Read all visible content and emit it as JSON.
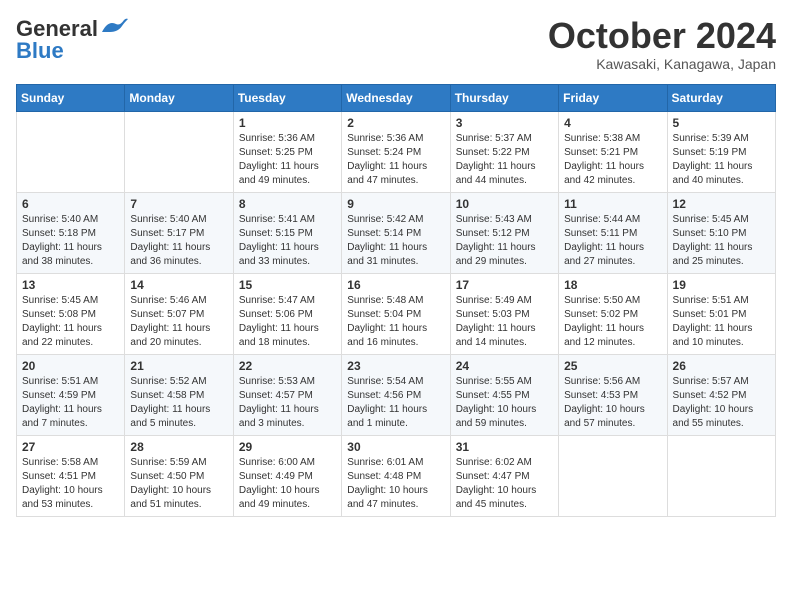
{
  "logo": {
    "general": "General",
    "blue": "Blue"
  },
  "title": "October 2024",
  "location": "Kawasaki, Kanagawa, Japan",
  "days": [
    "Sunday",
    "Monday",
    "Tuesday",
    "Wednesday",
    "Thursday",
    "Friday",
    "Saturday"
  ],
  "weeks": [
    [
      {
        "day": "",
        "sunrise": "",
        "sunset": "",
        "daylight": ""
      },
      {
        "day": "",
        "sunrise": "",
        "sunset": "",
        "daylight": ""
      },
      {
        "day": "1",
        "sunrise": "Sunrise: 5:36 AM",
        "sunset": "Sunset: 5:25 PM",
        "daylight": "Daylight: 11 hours and 49 minutes."
      },
      {
        "day": "2",
        "sunrise": "Sunrise: 5:36 AM",
        "sunset": "Sunset: 5:24 PM",
        "daylight": "Daylight: 11 hours and 47 minutes."
      },
      {
        "day": "3",
        "sunrise": "Sunrise: 5:37 AM",
        "sunset": "Sunset: 5:22 PM",
        "daylight": "Daylight: 11 hours and 44 minutes."
      },
      {
        "day": "4",
        "sunrise": "Sunrise: 5:38 AM",
        "sunset": "Sunset: 5:21 PM",
        "daylight": "Daylight: 11 hours and 42 minutes."
      },
      {
        "day": "5",
        "sunrise": "Sunrise: 5:39 AM",
        "sunset": "Sunset: 5:19 PM",
        "daylight": "Daylight: 11 hours and 40 minutes."
      }
    ],
    [
      {
        "day": "6",
        "sunrise": "Sunrise: 5:40 AM",
        "sunset": "Sunset: 5:18 PM",
        "daylight": "Daylight: 11 hours and 38 minutes."
      },
      {
        "day": "7",
        "sunrise": "Sunrise: 5:40 AM",
        "sunset": "Sunset: 5:17 PM",
        "daylight": "Daylight: 11 hours and 36 minutes."
      },
      {
        "day": "8",
        "sunrise": "Sunrise: 5:41 AM",
        "sunset": "Sunset: 5:15 PM",
        "daylight": "Daylight: 11 hours and 33 minutes."
      },
      {
        "day": "9",
        "sunrise": "Sunrise: 5:42 AM",
        "sunset": "Sunset: 5:14 PM",
        "daylight": "Daylight: 11 hours and 31 minutes."
      },
      {
        "day": "10",
        "sunrise": "Sunrise: 5:43 AM",
        "sunset": "Sunset: 5:12 PM",
        "daylight": "Daylight: 11 hours and 29 minutes."
      },
      {
        "day": "11",
        "sunrise": "Sunrise: 5:44 AM",
        "sunset": "Sunset: 5:11 PM",
        "daylight": "Daylight: 11 hours and 27 minutes."
      },
      {
        "day": "12",
        "sunrise": "Sunrise: 5:45 AM",
        "sunset": "Sunset: 5:10 PM",
        "daylight": "Daylight: 11 hours and 25 minutes."
      }
    ],
    [
      {
        "day": "13",
        "sunrise": "Sunrise: 5:45 AM",
        "sunset": "Sunset: 5:08 PM",
        "daylight": "Daylight: 11 hours and 22 minutes."
      },
      {
        "day": "14",
        "sunrise": "Sunrise: 5:46 AM",
        "sunset": "Sunset: 5:07 PM",
        "daylight": "Daylight: 11 hours and 20 minutes."
      },
      {
        "day": "15",
        "sunrise": "Sunrise: 5:47 AM",
        "sunset": "Sunset: 5:06 PM",
        "daylight": "Daylight: 11 hours and 18 minutes."
      },
      {
        "day": "16",
        "sunrise": "Sunrise: 5:48 AM",
        "sunset": "Sunset: 5:04 PM",
        "daylight": "Daylight: 11 hours and 16 minutes."
      },
      {
        "day": "17",
        "sunrise": "Sunrise: 5:49 AM",
        "sunset": "Sunset: 5:03 PM",
        "daylight": "Daylight: 11 hours and 14 minutes."
      },
      {
        "day": "18",
        "sunrise": "Sunrise: 5:50 AM",
        "sunset": "Sunset: 5:02 PM",
        "daylight": "Daylight: 11 hours and 12 minutes."
      },
      {
        "day": "19",
        "sunrise": "Sunrise: 5:51 AM",
        "sunset": "Sunset: 5:01 PM",
        "daylight": "Daylight: 11 hours and 10 minutes."
      }
    ],
    [
      {
        "day": "20",
        "sunrise": "Sunrise: 5:51 AM",
        "sunset": "Sunset: 4:59 PM",
        "daylight": "Daylight: 11 hours and 7 minutes."
      },
      {
        "day": "21",
        "sunrise": "Sunrise: 5:52 AM",
        "sunset": "Sunset: 4:58 PM",
        "daylight": "Daylight: 11 hours and 5 minutes."
      },
      {
        "day": "22",
        "sunrise": "Sunrise: 5:53 AM",
        "sunset": "Sunset: 4:57 PM",
        "daylight": "Daylight: 11 hours and 3 minutes."
      },
      {
        "day": "23",
        "sunrise": "Sunrise: 5:54 AM",
        "sunset": "Sunset: 4:56 PM",
        "daylight": "Daylight: 11 hours and 1 minute."
      },
      {
        "day": "24",
        "sunrise": "Sunrise: 5:55 AM",
        "sunset": "Sunset: 4:55 PM",
        "daylight": "Daylight: 10 hours and 59 minutes."
      },
      {
        "day": "25",
        "sunrise": "Sunrise: 5:56 AM",
        "sunset": "Sunset: 4:53 PM",
        "daylight": "Daylight: 10 hours and 57 minutes."
      },
      {
        "day": "26",
        "sunrise": "Sunrise: 5:57 AM",
        "sunset": "Sunset: 4:52 PM",
        "daylight": "Daylight: 10 hours and 55 minutes."
      }
    ],
    [
      {
        "day": "27",
        "sunrise": "Sunrise: 5:58 AM",
        "sunset": "Sunset: 4:51 PM",
        "daylight": "Daylight: 10 hours and 53 minutes."
      },
      {
        "day": "28",
        "sunrise": "Sunrise: 5:59 AM",
        "sunset": "Sunset: 4:50 PM",
        "daylight": "Daylight: 10 hours and 51 minutes."
      },
      {
        "day": "29",
        "sunrise": "Sunrise: 6:00 AM",
        "sunset": "Sunset: 4:49 PM",
        "daylight": "Daylight: 10 hours and 49 minutes."
      },
      {
        "day": "30",
        "sunrise": "Sunrise: 6:01 AM",
        "sunset": "Sunset: 4:48 PM",
        "daylight": "Daylight: 10 hours and 47 minutes."
      },
      {
        "day": "31",
        "sunrise": "Sunrise: 6:02 AM",
        "sunset": "Sunset: 4:47 PM",
        "daylight": "Daylight: 10 hours and 45 minutes."
      },
      {
        "day": "",
        "sunrise": "",
        "sunset": "",
        "daylight": ""
      },
      {
        "day": "",
        "sunrise": "",
        "sunset": "",
        "daylight": ""
      }
    ]
  ]
}
